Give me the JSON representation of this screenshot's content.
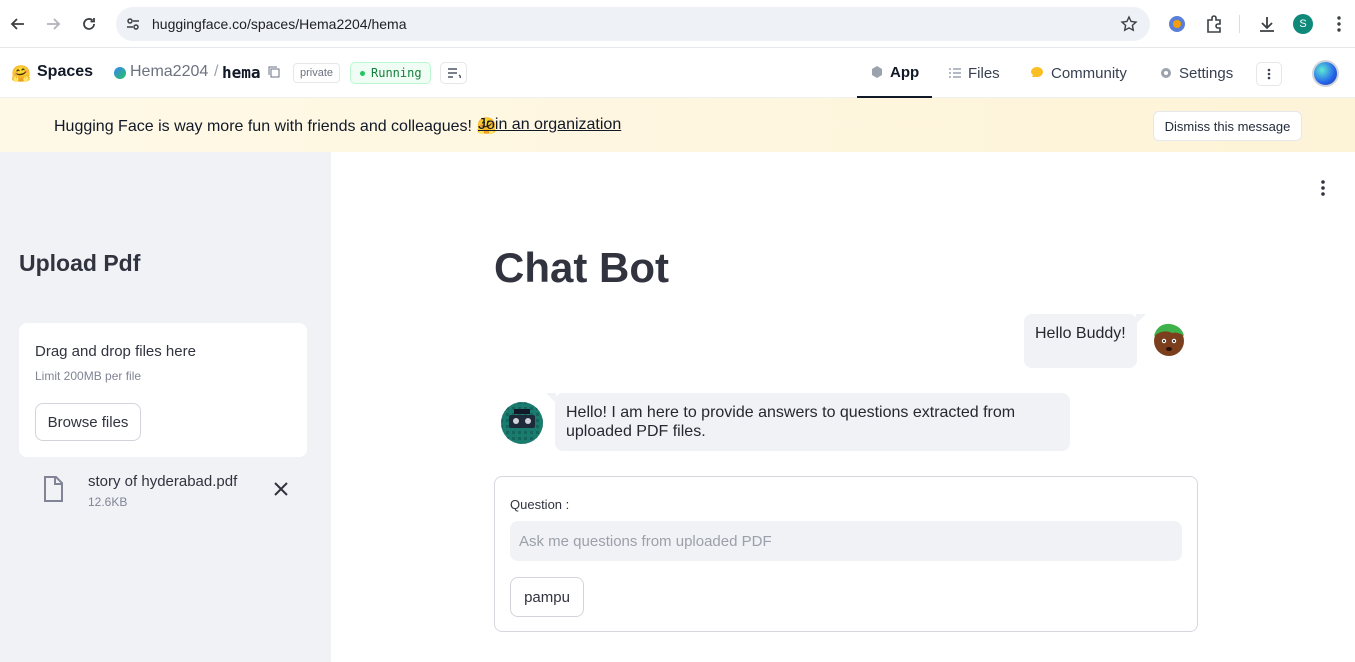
{
  "browser": {
    "url": "huggingface.co/spaces/Hema2204/hema",
    "profile_initial": "S"
  },
  "header": {
    "spaces_label": "Spaces",
    "owner": "Hema2204",
    "separator": "/",
    "repo": "hema",
    "visibility_badge": "private",
    "status_badge": "Running",
    "tabs": [
      {
        "label": "App",
        "icon": "cube-icon",
        "active": true
      },
      {
        "label": "Files",
        "icon": "list-icon",
        "active": false
      },
      {
        "label": "Community",
        "icon": "community-icon",
        "active": false
      },
      {
        "label": "Settings",
        "icon": "gear-icon",
        "active": false
      }
    ]
  },
  "banner": {
    "text": "Hugging Face is way more fun with friends and colleagues! 🤗",
    "link": "Join an organization",
    "dismiss": "Dismiss this message",
    "bg_color": "#fef9e7"
  },
  "sidebar": {
    "title": "Upload Pdf",
    "dropzone_title": "Drag and drop files here",
    "dropzone_limit": "Limit 200MB per file",
    "browse_button": "Browse files",
    "file": {
      "name": "story of hyderabad.pdf",
      "size": "12.6KB"
    }
  },
  "main": {
    "title": "Chat Bot",
    "messages": [
      {
        "role": "user",
        "text": "Hello Buddy!"
      },
      {
        "role": "bot",
        "text": "Hello! I am here to provide answers to questions extracted from uploaded PDF files."
      }
    ],
    "form": {
      "label": "Question :",
      "placeholder": "Ask me questions from uploaded PDF",
      "value": "",
      "submit": "pampu"
    }
  }
}
